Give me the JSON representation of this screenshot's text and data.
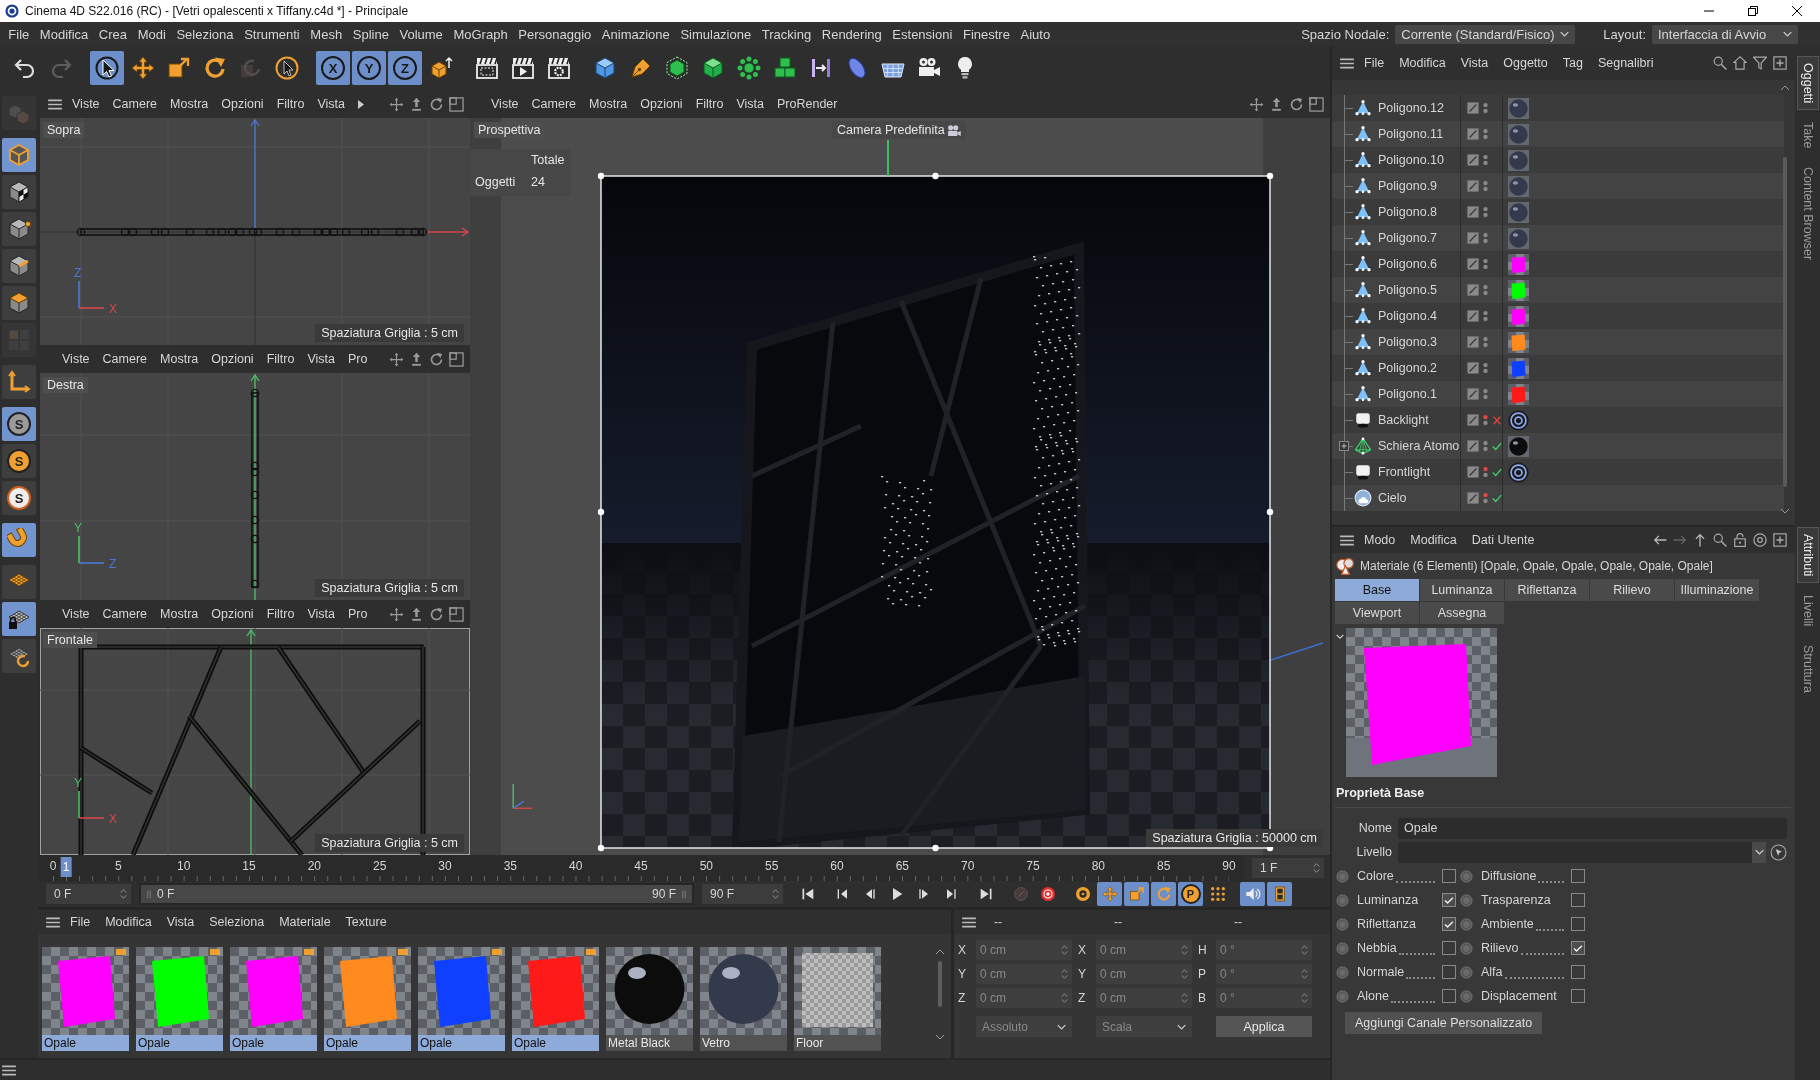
{
  "window": {
    "title": "Cinema 4D S22.016 (RC) - [Vetri opalescenti x Tiffany.c4d *] - Principale"
  },
  "menu_bar": {
    "items": [
      "File",
      "Modifica",
      "Crea",
      "Modi",
      "Seleziona",
      "Strumenti",
      "Mesh",
      "Spline",
      "Volume",
      "MoGraph",
      "Personaggio",
      "Animazione",
      "Simulazione",
      "Tracking",
      "Rendering",
      "Estensioni",
      "Finestre",
      "Aiuto"
    ],
    "node_space": {
      "label": "Spazio Nodale:",
      "value": "Corrente (Standard/Fisico)"
    },
    "layout": {
      "label": "Layout:",
      "value": "Interfaccia di Avvio"
    }
  },
  "toolbar": {
    "groups": [
      [
        {
          "kind": "undo",
          "active": false,
          "disabled": false
        },
        {
          "kind": "redo",
          "active": false,
          "disabled": true
        }
      ],
      [
        {
          "kind": "live_select",
          "active": true,
          "disabled": false
        },
        {
          "kind": "move",
          "active": false,
          "disabled": false
        },
        {
          "kind": "scale",
          "active": false,
          "disabled": false
        },
        {
          "kind": "rotate",
          "active": false,
          "disabled": false
        },
        {
          "kind": "recent",
          "active": false,
          "disabled": true
        },
        {
          "kind": "pointer",
          "active": false,
          "disabled": false
        }
      ],
      [
        {
          "kind": "axis",
          "label": "X",
          "active": true,
          "disabled": false
        },
        {
          "kind": "axis",
          "label": "Y",
          "active": true,
          "disabled": false
        },
        {
          "kind": "axis",
          "label": "Z",
          "active": true,
          "disabled": false
        },
        {
          "kind": "coords",
          "active": false,
          "disabled": false
        }
      ],
      [
        {
          "kind": "render_region",
          "active": false,
          "disabled": false
        },
        {
          "kind": "render_view",
          "active": false,
          "disabled": false
        },
        {
          "kind": "render_settings",
          "active": false,
          "disabled": false
        }
      ],
      [
        {
          "kind": "cube",
          "active": false,
          "disabled": false
        },
        {
          "kind": "pen",
          "active": false,
          "disabled": false
        },
        {
          "kind": "subdivide",
          "active": false,
          "disabled": false
        },
        {
          "kind": "extrude",
          "active": false,
          "disabled": false
        },
        {
          "kind": "cloner",
          "active": false,
          "disabled": false
        },
        {
          "kind": "cubes",
          "active": false,
          "disabled": false
        },
        {
          "kind": "bend",
          "active": false,
          "disabled": false
        },
        {
          "kind": "field",
          "active": false,
          "disabled": false
        },
        {
          "kind": "floor",
          "active": false,
          "disabled": false
        },
        {
          "kind": "camera",
          "active": false,
          "disabled": false
        },
        {
          "kind": "light",
          "active": false,
          "disabled": false
        }
      ]
    ]
  },
  "tool_palette": {
    "groups": [
      [
        {
          "kind": "make_editable",
          "active": false,
          "disabled": true
        }
      ],
      [
        {
          "kind": "model",
          "active": true,
          "disabled": false
        },
        {
          "kind": "texture",
          "active": false,
          "disabled": false
        },
        {
          "kind": "points",
          "active": false,
          "disabled": false
        },
        {
          "kind": "edges",
          "active": false,
          "disabled": false
        },
        {
          "kind": "polygons",
          "active": false,
          "disabled": false
        },
        {
          "kind": "uv",
          "active": false,
          "disabled": true
        }
      ],
      [
        {
          "kind": "axis_mode",
          "active": false,
          "disabled": false
        }
      ],
      [
        {
          "kind": "solo",
          "label": "S",
          "active": true,
          "disabled": false
        },
        {
          "kind": "solo_child",
          "label": "S",
          "active": false,
          "disabled": false
        },
        {
          "kind": "solo_off",
          "label": "S",
          "active": false,
          "disabled": false
        }
      ],
      [
        {
          "kind": "snap",
          "active": true,
          "disabled": false
        }
      ],
      [
        {
          "kind": "workplane",
          "active": false,
          "disabled": false
        },
        {
          "kind": "workplane_lock",
          "active": true,
          "disabled": false
        },
        {
          "kind": "workplane_align",
          "active": false,
          "disabled": false
        }
      ]
    ]
  },
  "side_viewports": [
    {
      "kind": "top",
      "menu_icon": true,
      "menu": [
        "Viste",
        "Camere",
        "Mostra",
        "Opzioni",
        "Filtro",
        "Vista"
      ],
      "overflow_arrow": true,
      "label": "Sopra",
      "grid_spacing": "Spaziatura Griglia : 5 cm",
      "axes": {
        "up": "Z",
        "right": "X"
      },
      "active": false
    },
    {
      "kind": "right",
      "menu_icon": false,
      "menu": [
        "Viste",
        "Camere",
        "Mostra",
        "Opzioni",
        "Filtro",
        "Vista",
        "Pro"
      ],
      "overflow_arrow": false,
      "label": "Destra",
      "grid_spacing": "Spaziatura Griglia : 5 cm",
      "axes": {
        "up": "Y",
        "right": "Z"
      },
      "active": false
    },
    {
      "kind": "front",
      "menu_icon": false,
      "menu": [
        "Viste",
        "Camere",
        "Mostra",
        "Opzioni",
        "Filtro",
        "Vista",
        "Pro"
      ],
      "overflow_arrow": false,
      "label": "Frontale",
      "grid_spacing": "Spaziatura Griglia : 5 cm",
      "axes": {
        "up": "Y",
        "right": "X"
      },
      "active": true
    }
  ],
  "perspective_viewport": {
    "menu": [
      "Viste",
      "Camere",
      "Mostra",
      "Opzioni",
      "Filtro",
      "Vista",
      "ProRender"
    ],
    "label": "Prospettiva",
    "camera": "Camera Predefinita",
    "hud": {
      "header": "Totale",
      "rows": [
        {
          "label": "Oggetti",
          "value": "24"
        }
      ]
    },
    "grid_spacing": "Spaziatura Griglia : 50000 cm"
  },
  "timeline": {
    "ticks": [
      "0",
      "5",
      "10",
      "15",
      "20",
      "25",
      "30",
      "35",
      "40",
      "45",
      "50",
      "55",
      "60",
      "65",
      "70",
      "75",
      "80",
      "85",
      "90"
    ],
    "playhead": {
      "label": "1",
      "level": 0.0111
    },
    "current_frame": "1 F",
    "start_field": "0 F",
    "range": {
      "start": "0 F",
      "end": "90 F",
      "level": 1
    },
    "end_field": "90 F",
    "buttons": [
      [
        {
          "kind": "go_start",
          "active": false,
          "disabled": false
        }
      ],
      [
        {
          "kind": "prev_key",
          "active": false,
          "disabled": false
        },
        {
          "kind": "prev_frame",
          "active": false,
          "disabled": false
        },
        {
          "kind": "play",
          "active": false,
          "disabled": false
        },
        {
          "kind": "next_frame",
          "active": false,
          "disabled": false
        },
        {
          "kind": "next_key",
          "active": false,
          "disabled": false
        }
      ],
      [
        {
          "kind": "go_end",
          "active": false,
          "disabled": false
        }
      ],
      [
        {
          "kind": "record",
          "active": false,
          "disabled": true
        },
        {
          "kind": "autokey",
          "active": false,
          "disabled": false
        }
      ],
      [
        {
          "kind": "key_sel",
          "active": false,
          "disabled": false
        },
        {
          "kind": "key_move",
          "active": true,
          "disabled": false
        },
        {
          "kind": "key_scale",
          "active": true,
          "disabled": false
        },
        {
          "kind": "key_rotate",
          "active": true,
          "disabled": false
        },
        {
          "kind": "key_param",
          "label": "P",
          "active": true,
          "disabled": false
        },
        {
          "kind": "key_pla",
          "active": false,
          "disabled": false
        }
      ],
      [
        {
          "kind": "sound",
          "active": true,
          "disabled": false
        },
        {
          "kind": "film",
          "active": true,
          "disabled": false
        }
      ]
    ]
  },
  "material_manager": {
    "menu": [
      "File",
      "Modifica",
      "Vista",
      "Seleziona",
      "Materiale",
      "Texture"
    ],
    "materials": [
      {
        "name": "Opale",
        "kind": "plane",
        "color": "#ff00ff",
        "selected": true,
        "flagged": true
      },
      {
        "name": "Opale",
        "kind": "plane",
        "color": "#00ff00",
        "selected": true,
        "flagged": true
      },
      {
        "name": "Opale",
        "kind": "plane",
        "color": "#ff00ff",
        "selected": true,
        "flagged": true
      },
      {
        "name": "Opale",
        "kind": "plane",
        "color": "#ff8a1e",
        "selected": true,
        "flagged": true
      },
      {
        "name": "Opale",
        "kind": "plane",
        "color": "#1040ff",
        "selected": true,
        "flagged": true
      },
      {
        "name": "Opale",
        "kind": "plane",
        "color": "#ff1a1a",
        "selected": true,
        "flagged": true
      },
      {
        "name": "Metal Black",
        "kind": "sphere",
        "color": "#0c0c0c",
        "selected": false,
        "flagged": false
      },
      {
        "name": "Vetro",
        "kind": "sphere",
        "color": "#323a4c",
        "selected": false,
        "flagged": false
      },
      {
        "name": "Floor",
        "kind": "floor",
        "selected": false,
        "flagged": false
      }
    ]
  },
  "coordinates": {
    "headers": [
      "--",
      "--",
      "--"
    ],
    "rows": [
      [
        {
          "axis": "X",
          "value": "0 cm"
        },
        {
          "axis": "X",
          "value": "0 cm"
        },
        {
          "axis": "H",
          "value": "0 °"
        }
      ],
      [
        {
          "axis": "Y",
          "value": "0 cm"
        },
        {
          "axis": "Y",
          "value": "0 cm"
        },
        {
          "axis": "P",
          "value": "0 °"
        }
      ],
      [
        {
          "axis": "Z",
          "value": "0 cm"
        },
        {
          "axis": "Z",
          "value": "0 cm"
        },
        {
          "axis": "B",
          "value": "0 °"
        }
      ]
    ],
    "mode": "Assoluto",
    "scale_mode": "Scala",
    "apply": "Applica",
    "disabled": true
  },
  "object_manager": {
    "menu": [
      "File",
      "Modifica",
      "Vista",
      "Oggetto",
      "Tag",
      "Segnalibri"
    ],
    "objects": [
      {
        "name": "Poligono.12",
        "kind": "polygon",
        "collapsed": false,
        "editor_hidden": false,
        "tags": [
          {
            "kind": "sphere",
            "color": "#323a4c"
          }
        ]
      },
      {
        "name": "Poligono.11",
        "kind": "polygon",
        "collapsed": false,
        "editor_hidden": false,
        "tags": [
          {
            "kind": "sphere",
            "color": "#323a4c"
          }
        ]
      },
      {
        "name": "Poligono.10",
        "kind": "polygon",
        "collapsed": false,
        "editor_hidden": false,
        "tags": [
          {
            "kind": "sphere",
            "color": "#323a4c"
          }
        ]
      },
      {
        "name": "Poligono.9",
        "kind": "polygon",
        "collapsed": false,
        "editor_hidden": false,
        "tags": [
          {
            "kind": "sphere",
            "color": "#323a4c"
          }
        ]
      },
      {
        "name": "Poligono.8",
        "kind": "polygon",
        "collapsed": false,
        "editor_hidden": false,
        "tags": [
          {
            "kind": "sphere",
            "color": "#323a4c"
          }
        ]
      },
      {
        "name": "Poligono.7",
        "kind": "polygon",
        "collapsed": false,
        "editor_hidden": false,
        "tags": [
          {
            "kind": "sphere",
            "color": "#323a4c"
          }
        ]
      },
      {
        "name": "Poligono.6",
        "kind": "polygon",
        "collapsed": false,
        "editor_hidden": false,
        "tags": [
          {
            "kind": "plane",
            "color": "#ff00ff"
          }
        ]
      },
      {
        "name": "Poligono.5",
        "kind": "polygon",
        "collapsed": false,
        "editor_hidden": false,
        "tags": [
          {
            "kind": "plane",
            "color": "#00ff00"
          }
        ]
      },
      {
        "name": "Poligono.4",
        "kind": "polygon",
        "collapsed": false,
        "editor_hidden": false,
        "tags": [
          {
            "kind": "plane",
            "color": "#ff00ff"
          }
        ]
      },
      {
        "name": "Poligono.3",
        "kind": "polygon",
        "collapsed": false,
        "editor_hidden": false,
        "tags": [
          {
            "kind": "plane",
            "color": "#ff8a1e"
          }
        ]
      },
      {
        "name": "Poligono.2",
        "kind": "polygon",
        "collapsed": false,
        "editor_hidden": false,
        "tags": [
          {
            "kind": "plane",
            "color": "#1040ff"
          }
        ]
      },
      {
        "name": "Poligono.1",
        "kind": "polygon",
        "collapsed": false,
        "editor_hidden": false,
        "tags": [
          {
            "kind": "plane",
            "color": "#ff1a1a"
          }
        ]
      },
      {
        "name": "Backlight",
        "kind": "light",
        "collapsed": false,
        "editor_hidden": true,
        "enabled": false,
        "tags": [
          {
            "kind": "target"
          }
        ]
      },
      {
        "name": "Schiera Atomo",
        "kind": "atom_array",
        "collapsed": true,
        "editor_hidden": false,
        "enabled": true,
        "tags": [
          {
            "kind": "sphere",
            "color": "#0c0c0c"
          }
        ]
      },
      {
        "name": "Frontlight",
        "kind": "light",
        "collapsed": false,
        "editor_hidden": true,
        "enabled": true,
        "tags": [
          {
            "kind": "target"
          }
        ]
      },
      {
        "name": "Cielo",
        "kind": "sky",
        "collapsed": false,
        "editor_hidden": true,
        "enabled": true
      }
    ]
  },
  "side_tabs": {
    "top": [
      {
        "label": "Oggetti",
        "selected": true
      },
      {
        "label": "Take",
        "selected": false
      },
      {
        "label": "Content Browser",
        "selected": false
      }
    ],
    "bottom": [
      {
        "label": "Attributi",
        "selected": true
      },
      {
        "label": "Livelli",
        "selected": false
      },
      {
        "label": "Struttura",
        "selected": false
      }
    ]
  },
  "attributes": {
    "menu": [
      "Modo",
      "Modifica",
      "Dati Utente"
    ],
    "title": "Materiale (6 Elementi) [Opale, Opale, Opale, Opale, Opale, Opale]",
    "tabs": [
      {
        "label": "Base",
        "selected": true
      },
      {
        "label": "Luminanza",
        "selected": false
      },
      {
        "label": "Riflettanza",
        "selected": false
      },
      {
        "label": "Rilievo",
        "selected": false
      },
      {
        "label": "Illuminazione",
        "selected": false
      },
      {
        "label": "Viewport",
        "selected": false
      },
      {
        "label": "Assegna",
        "selected": false
      }
    ],
    "section": "Proprietà Base",
    "name_field": {
      "label": "Nome",
      "value": "Opale"
    },
    "layer_field": {
      "label": "Livello"
    },
    "channels": [
      {
        "label": "Colore",
        "leader": true,
        "checked": false
      },
      {
        "label": "Diffusione",
        "leader": true,
        "checked": false
      },
      {
        "label": "Luminanza",
        "leader": false,
        "checked": true
      },
      {
        "label": "Trasparenza",
        "leader": false,
        "checked": false
      },
      {
        "label": "Riflettanza",
        "leader": false,
        "checked": true
      },
      {
        "label": "Ambiente",
        "leader": true,
        "checked": false
      },
      {
        "label": "Nebbia",
        "leader": true,
        "checked": false
      },
      {
        "label": "Rilievo",
        "leader": true,
        "checked": true
      },
      {
        "label": "Normale",
        "leader": true,
        "checked": false
      },
      {
        "label": "Alfa",
        "leader": true,
        "checked": false
      },
      {
        "label": "Alone",
        "leader": true,
        "checked": false
      },
      {
        "label": "Displacement",
        "leader": false,
        "checked": false
      }
    ],
    "button": "Aggiungi Canale Personalizzato"
  }
}
